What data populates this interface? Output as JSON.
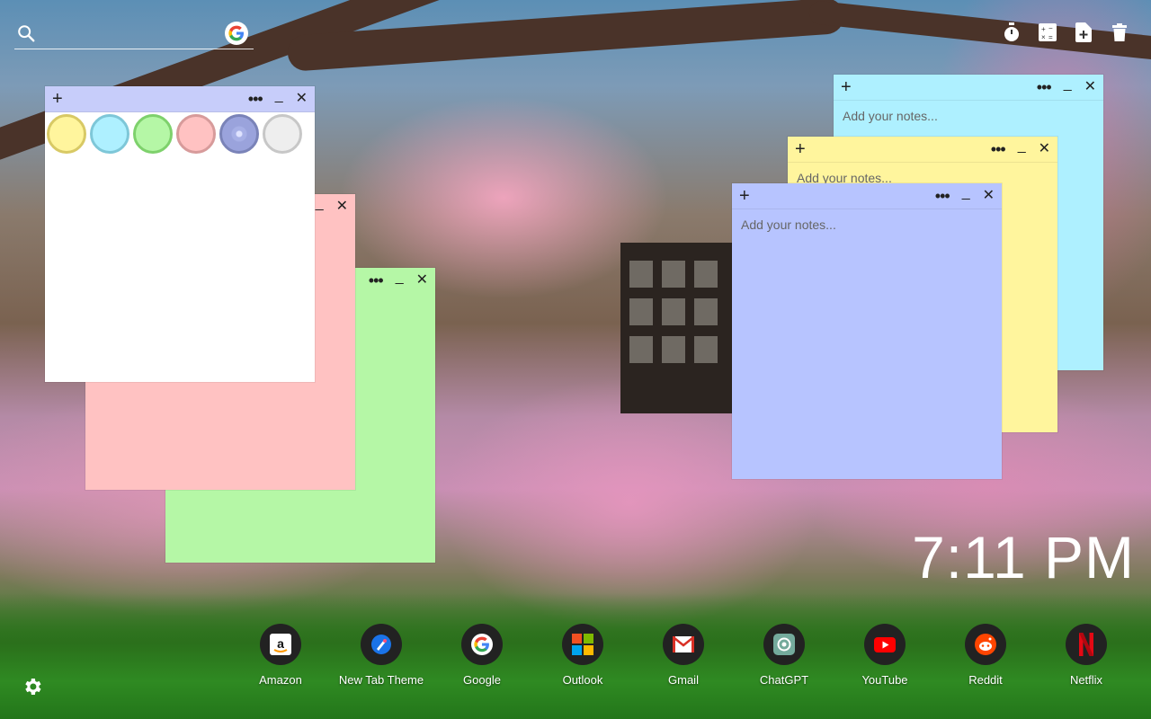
{
  "search": {
    "value": "",
    "placeholder": ""
  },
  "toolbar": {
    "timer_icon": "stopwatch-icon",
    "calculator_icon": "calculator-icon",
    "new_note_icon": "new-note-icon",
    "trash_icon": "trash-icon"
  },
  "color_picker": {
    "swatches": [
      {
        "name": "yellow",
        "fill": "#fff59d",
        "border": "#d8c965"
      },
      {
        "name": "cyan",
        "fill": "#aef0ff",
        "border": "#7ec7d8"
      },
      {
        "name": "green",
        "fill": "#b5f7a6",
        "border": "#7ed16c"
      },
      {
        "name": "pink",
        "fill": "#ffc2c2",
        "border": "#d79b9b"
      },
      {
        "name": "blue",
        "fill": "#a7b0e6",
        "border": "#7a83b8"
      },
      {
        "name": "white",
        "fill": "#eeeeee",
        "border": "#c7c7c7"
      }
    ]
  },
  "notes": {
    "header_add": "+",
    "header_more": "•••",
    "header_min": "_",
    "header_close": "✕",
    "cyan": {
      "placeholder": "Add your notes...",
      "color": "#aef0ff"
    },
    "yellow": {
      "placeholder": "Add your notes...",
      "color": "#fff59d"
    },
    "blue": {
      "placeholder": "Add your notes...",
      "color": "#b7c4ff"
    },
    "pink": {
      "color": "#ffc2c2"
    },
    "green": {
      "color": "#b5f7a6"
    },
    "white": {
      "color": "#ffffff"
    }
  },
  "clock": {
    "time": "7:11 PM"
  },
  "dock": {
    "apps": [
      {
        "label": "Amazon",
        "icon": "amazon-icon"
      },
      {
        "label": "New Tab Theme",
        "icon": "new-tab-theme-icon"
      },
      {
        "label": "Google",
        "icon": "google-icon"
      },
      {
        "label": "Outlook",
        "icon": "outlook-icon"
      },
      {
        "label": "Gmail",
        "icon": "gmail-icon"
      },
      {
        "label": "ChatGPT",
        "icon": "chatgpt-icon"
      },
      {
        "label": "YouTube",
        "icon": "youtube-icon"
      },
      {
        "label": "Reddit",
        "icon": "reddit-icon"
      },
      {
        "label": "Netflix",
        "icon": "netflix-icon"
      }
    ]
  },
  "settings": {
    "icon": "gear-icon"
  }
}
